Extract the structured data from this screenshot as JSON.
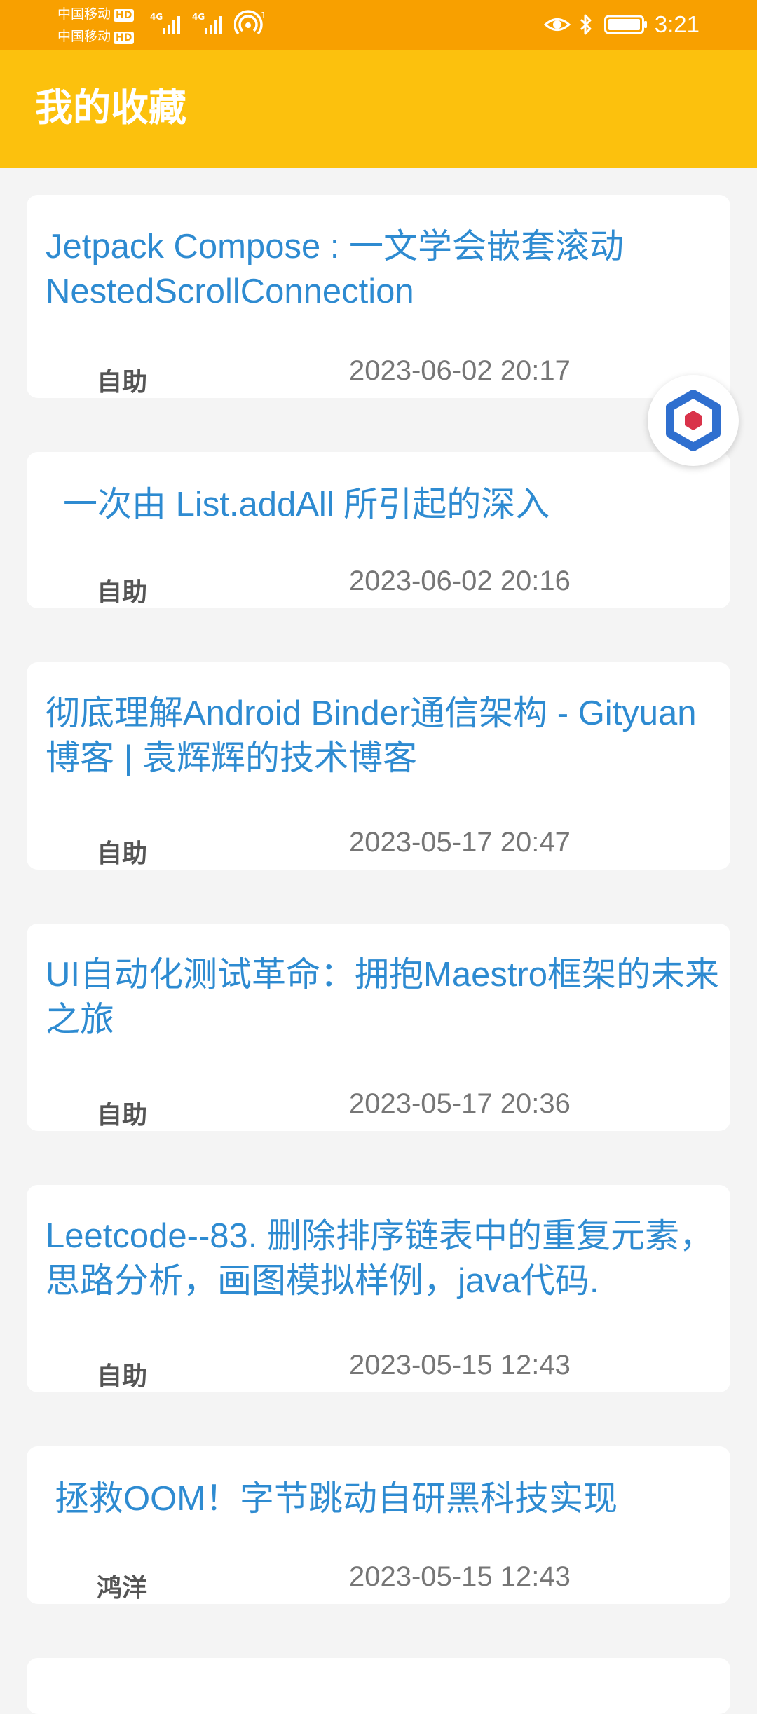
{
  "status_bar": {
    "carrier1": "中国移动",
    "carrier2": "中国移动",
    "hd": "HD",
    "time": "3:21",
    "icons": [
      "signal-4g-icon",
      "hotspot-icon",
      "eye-icon",
      "bluetooth-icon",
      "battery-icon"
    ]
  },
  "header": {
    "title": "我的收藏"
  },
  "colors": {
    "status_bar": "#f8a000",
    "app_bar": "#fcc10d",
    "title_link": "#2e8bd1",
    "background": "#f4f4f4"
  },
  "favorites": [
    {
      "title": "Jetpack Compose : 一文学会嵌套滚动NestedScrollConnection",
      "author": "自助",
      "date": "2023-06-02 20:17"
    },
    {
      "title": "一次由 List.addAll 所引起的深入",
      "author": "自助",
      "date": "2023-06-02 20:16"
    },
    {
      "title": "彻底理解Android Binder通信架构 - Gityuan博客 | 袁辉辉的技术博客",
      "author": "自助",
      "date": "2023-05-17 20:47"
    },
    {
      "title": "UI自动化测试革命：拥抱Maestro框架的未来之旅",
      "author": "自助",
      "date": "2023-05-17 20:36"
    },
    {
      "title": "Leetcode--83. 删除排序链表中的重复元素，思路分析，画图模拟样例，java代码.",
      "author": "自助",
      "date": "2023-05-15 12:43"
    },
    {
      "title": "拯救OOM！字节跳动自研黑科技实现",
      "author": "鸿洋",
      "date": "2023-05-15 12:43"
    }
  ]
}
